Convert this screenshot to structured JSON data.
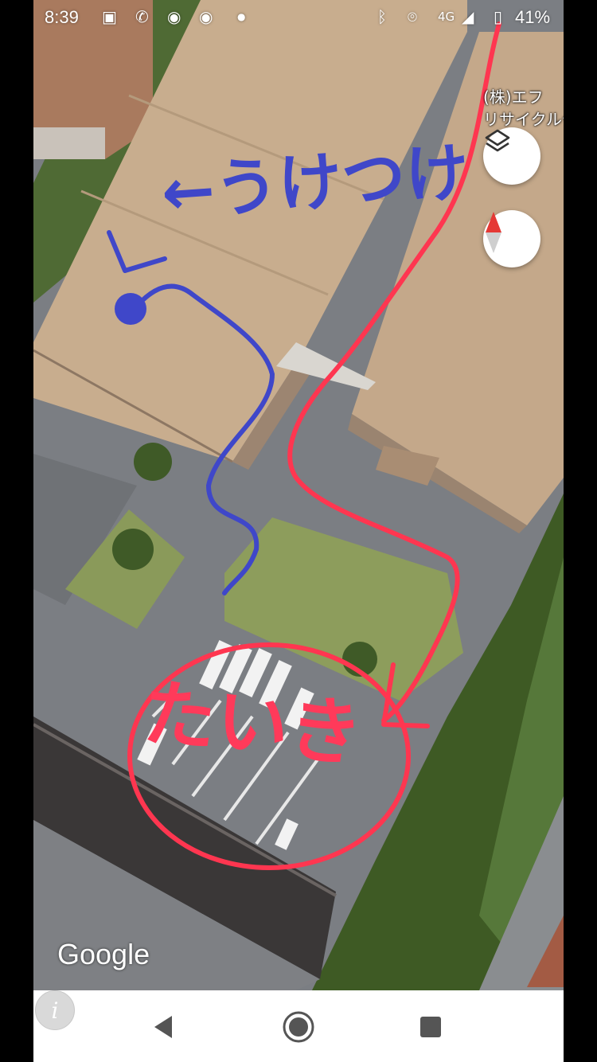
{
  "status_bar": {
    "time": "8:39",
    "network": "4G",
    "battery": "41%",
    "icons": [
      "image-icon",
      "wifi-calling-icon",
      "chrome-icon",
      "chrome-icon",
      "notification-dot-icon",
      "bluetooth-icon",
      "location-icon",
      "signal-icon",
      "battery-icon"
    ]
  },
  "map": {
    "view": "satellite",
    "place_label_line1": "(株)エフ",
    "place_label_line2": "リサイクルセン",
    "attribution": "Google",
    "layers_icon": "layers-icon",
    "compass_icon": "compass-icon",
    "info_icon": "info-icon",
    "info_label": "i"
  },
  "annotations": {
    "reception": {
      "text": "←うけつけ",
      "color": "#3f47c9"
    },
    "waiting": {
      "text": "たいき",
      "color": "#ff3a5a"
    }
  },
  "nav_bar": {
    "back_icon": "back-triangle-icon",
    "home_icon": "home-circle-icon",
    "recents_icon": "recents-square-icon"
  }
}
